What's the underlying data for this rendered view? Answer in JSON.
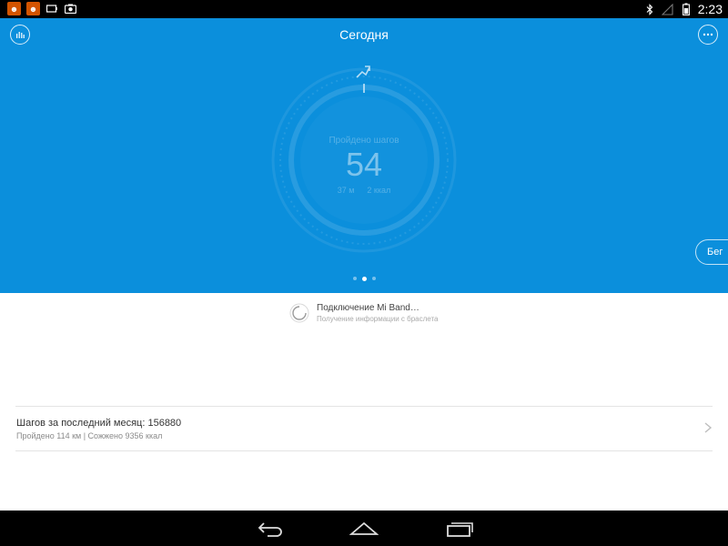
{
  "status_bar": {
    "time": "2:23",
    "left_icons": [
      "app-notification-icon",
      "app-notification-icon",
      "battery-outline-icon",
      "camera-icon"
    ],
    "right_icons": [
      "bluetooth-icon",
      "signal-icon",
      "battery-icon"
    ]
  },
  "header": {
    "title": "Сегодня",
    "stats_icon": "bar-chart-icon",
    "more_icon": "more-icon"
  },
  "dial": {
    "label": "Пройдено шагов",
    "steps": "54",
    "distance": "37 м",
    "calories": "2 ккал",
    "icon": "run-icon"
  },
  "run_button_label": "Бег",
  "pager": {
    "count": 3,
    "active": 1
  },
  "connection": {
    "title": "Подключение Mi Band…",
    "subtitle": "Получение информации с браслета"
  },
  "month_summary": {
    "title": "Шагов за последний месяц: 156880",
    "subtitle": "Пройдено 114 км | Сожжено 9356 ккал"
  },
  "colors": {
    "hero_background": "#0b8fdc",
    "status_bar": "#000000",
    "nav_bar": "#000000"
  }
}
